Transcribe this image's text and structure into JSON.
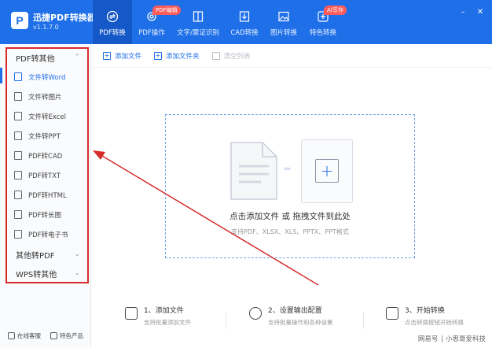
{
  "app": {
    "logo_letter": "P",
    "name": "迅捷PDF转换器",
    "version": "v1.1.7.0"
  },
  "nav": [
    {
      "label": "PDF转换",
      "icon": "convert-icon",
      "badge": ""
    },
    {
      "label": "PDF操作",
      "icon": "gear-icon",
      "badge": "PDF编辑"
    },
    {
      "label": "文字/票证识别",
      "icon": "ocr-icon",
      "badge": ""
    },
    {
      "label": "CAD转换",
      "icon": "cad-icon",
      "badge": ""
    },
    {
      "label": "图片转换",
      "icon": "image-icon",
      "badge": ""
    },
    {
      "label": "特色转换",
      "icon": "feature-icon",
      "badge": "AI写作"
    }
  ],
  "window": {
    "minimize": "–",
    "close": "✕"
  },
  "sidebar": {
    "category_pdf_to_other": "PDF转其他",
    "items": [
      {
        "label": "文件转Word"
      },
      {
        "label": "文件转图片"
      },
      {
        "label": "文件转Excel"
      },
      {
        "label": "文件转PPT"
      },
      {
        "label": "PDF转CAD"
      },
      {
        "label": "PDF转TXT"
      },
      {
        "label": "PDF转HTML"
      },
      {
        "label": "PDF转长图"
      },
      {
        "label": "PDF转电子书"
      }
    ],
    "category_other_to_pdf": "其他转PDF",
    "category_wps_to_other": "WPS转其他",
    "footer": {
      "service": "在线客服",
      "products": "特色产品"
    }
  },
  "toolbar": {
    "add_file": "添加文件",
    "add_folder": "添加文件夹",
    "clear_list": "清空列表"
  },
  "dropzone": {
    "title": "点击添加文件 或 拖拽文件到此处",
    "subtitle": "支持PDF、XLSX、XLS、PPTX、PPT格式",
    "arrows": "›››"
  },
  "steps": [
    {
      "title": "1、添加文件",
      "desc": "支持批量添加文件"
    },
    {
      "title": "2、设置输出配置",
      "desc": "支持批量操作和各种设置"
    },
    {
      "title": "3、开始转换",
      "desc": "点击转换按钮开始转换"
    }
  ],
  "watermark": {
    "source": "网易号",
    "author": "| 小思哥爱科技"
  },
  "colors": {
    "brand": "#1e6fe8",
    "annotation": "#d62b2b"
  }
}
